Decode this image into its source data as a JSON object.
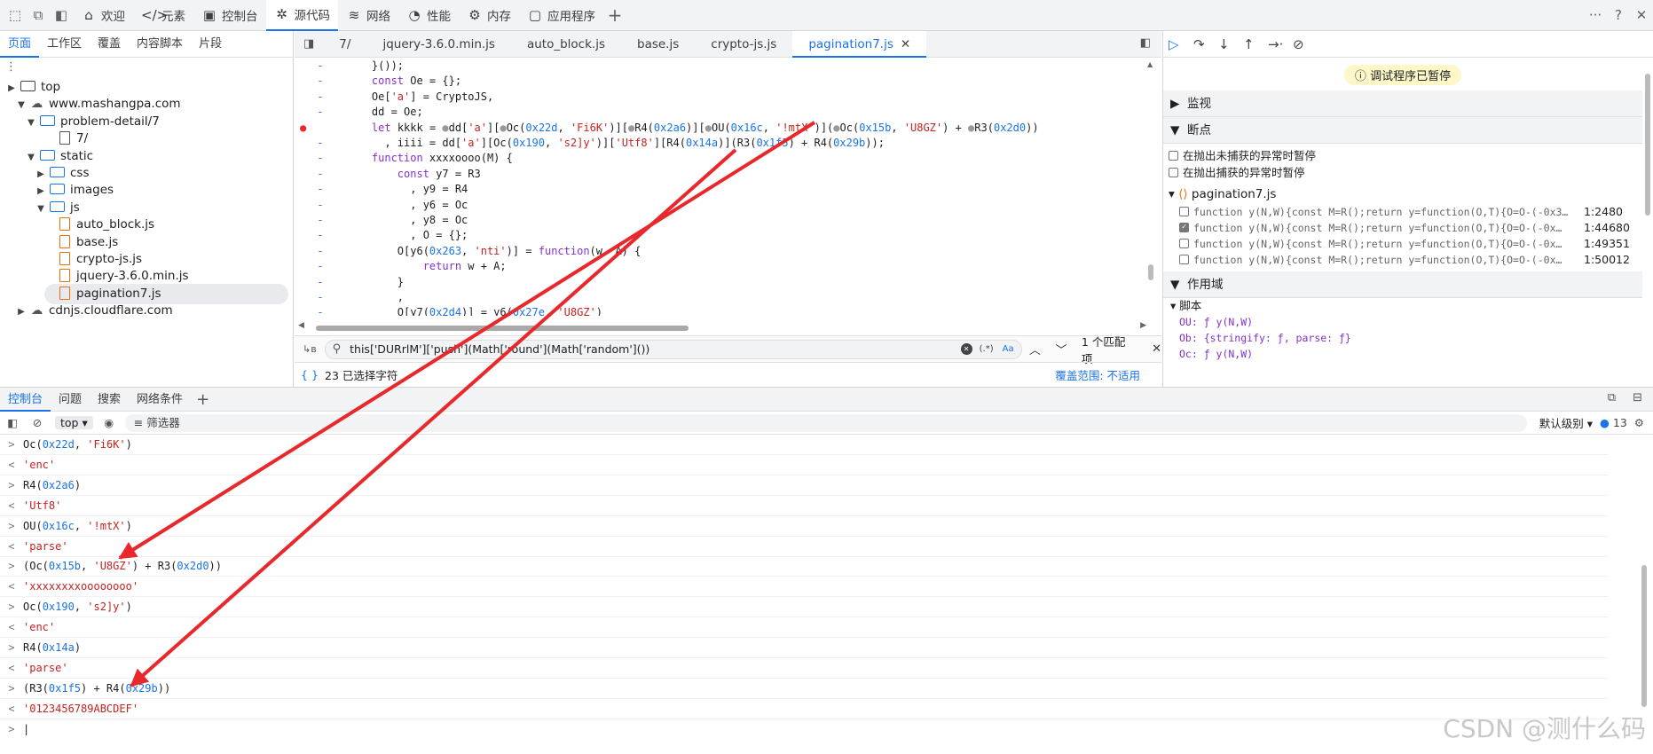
{
  "toolbar": {
    "tabs": [
      {
        "label": "欢迎",
        "icon": "home-icon",
        "glyph": "⌂"
      },
      {
        "label": "元素",
        "icon": "code-icon",
        "glyph": "</>"
      },
      {
        "label": "控制台",
        "icon": "console-icon",
        "glyph": "▣"
      },
      {
        "label": "源代码",
        "icon": "bug-icon",
        "glyph": "✲"
      },
      {
        "label": "网络",
        "icon": "wifi-icon",
        "glyph": "≋"
      },
      {
        "label": "性能",
        "icon": "gauge-icon",
        "glyph": "◔"
      },
      {
        "label": "内存",
        "icon": "gear-icon",
        "glyph": "⚙"
      },
      {
        "label": "应用程序",
        "icon": "app-icon",
        "glyph": "▢"
      }
    ],
    "add": "+",
    "more": "···",
    "help": "?",
    "close": "✕"
  },
  "navigator": {
    "tabs": [
      "页面",
      "工作区",
      "覆盖",
      "内容脚本",
      "片段"
    ],
    "tree": [
      {
        "label": "top",
        "type": "window",
        "indent": 0,
        "tri": "▶"
      },
      {
        "label": "www.mashangpa.com",
        "type": "cloud",
        "indent": 1,
        "tri": "▼"
      },
      {
        "label": "problem-detail/7",
        "type": "folder",
        "indent": 2,
        "tri": "▼"
      },
      {
        "label": "7/",
        "type": "plain",
        "indent": 4,
        "tri": ""
      },
      {
        "label": "static",
        "type": "folder",
        "indent": 2,
        "tri": "▼"
      },
      {
        "label": "css",
        "type": "folder",
        "indent": 3,
        "tri": "▶"
      },
      {
        "label": "images",
        "type": "folder",
        "indent": 3,
        "tri": "▶"
      },
      {
        "label": "js",
        "type": "folder",
        "indent": 3,
        "tri": "▼"
      },
      {
        "label": "auto_block.js",
        "type": "file",
        "indent": 4,
        "tri": ""
      },
      {
        "label": "base.js",
        "type": "file",
        "indent": 4,
        "tri": ""
      },
      {
        "label": "crypto-js.js",
        "type": "file",
        "indent": 4,
        "tri": ""
      },
      {
        "label": "jquery-3.6.0.min.js",
        "type": "file",
        "indent": 4,
        "tri": ""
      },
      {
        "label": "pagination7.js",
        "type": "file",
        "indent": 4,
        "tri": "",
        "selected": true
      },
      {
        "label": "cdnjs.cloudflare.com",
        "type": "cloud",
        "indent": 1,
        "tri": "▶"
      }
    ]
  },
  "editor": {
    "tabs": [
      "7/",
      "jquery-3.6.0.min.js",
      "auto_block.js",
      "base.js",
      "crypto-js.js",
      "pagination7.js"
    ],
    "code": [
      "    }());",
      "    const Oe = {};",
      "    Oe['a'] = CryptoJS,",
      "    dd = Oe;",
      "    let kkkk = ●dd['a'][●Oc(0x22d, 'Fi6K')][●R4(0x2a6)][●OU(0x16c, '!mtX')](●Oc(0x15b, 'U8GZ') + ●R3(0x2d0))",
      "      , iiii = dd['a'][Oc(0x190, 's2]y')]['Utf8'][R4(0x14a)](R3(0x1f5) + R4(0x29b));",
      "    function xxxxoooo(M) {",
      "        const y7 = R3",
      "          , y9 = R4",
      "          , y6 = Oc",
      "          , y8 = Oc",
      "          , O = {};",
      "        O[y6(0x263, 'nti')] = function(w, A) {",
      "            return w + A;",
      "        }",
      "        ,",
      "        O[y7(0x2d4)] = y6(0x27e, 'U8GZ')"
    ],
    "search": {
      "query": "this['DURrlM']['push'](Math['round'](Math['random']())",
      "matches": "1 个匹配项",
      "aa": "Aa",
      "regex": "(.*)"
    },
    "status": {
      "selected": "23 已选择字符",
      "coverage": "覆盖范围: 不适用"
    }
  },
  "debugger": {
    "paused": "调试程序已暂停",
    "watch": "监视",
    "breakpoints": "断点",
    "pause_uncaught": "在抛出未捕获的异常时暂停",
    "pause_caught": "在抛出捕获的异常时暂停",
    "bp_file": "pagination7.js",
    "bp_items": [
      {
        "code": "function y(N,W){const M=R();return y=function(O,T){O=O-(-0x3…",
        "loc": "1:2480",
        "checked": false
      },
      {
        "code": "function y(N,W){const M=R();return y=function(O,T){O=O-(-0x…",
        "loc": "1:44680",
        "checked": true
      },
      {
        "code": "function y(N,W){const M=R();return y=function(O,T){O=O-(-0x…",
        "loc": "1:49351",
        "checked": false
      },
      {
        "code": "function y(N,W){const M=R();return y=function(O,T){O=O-(-0x…",
        "loc": "1:50012",
        "checked": false
      }
    ],
    "scope": "作用域",
    "script": "脚本",
    "scope_items": [
      "OU: ƒ y(N,W)",
      "Ob: {stringify: ƒ, parse: ƒ}",
      "Oc: ƒ y(N,W)"
    ]
  },
  "console": {
    "tabs": [
      "控制台",
      "问题",
      "搜索",
      "网络条件"
    ],
    "context": "top",
    "filter": "筛选器",
    "level": "默认级别",
    "issues": "13",
    "rows": [
      {
        "dir": ">",
        "text": "Oc(0x22d, 'Fi6K')"
      },
      {
        "dir": "<",
        "text": "'enc'"
      },
      {
        "dir": ">",
        "text": "R4(0x2a6)"
      },
      {
        "dir": "<",
        "text": "'Utf8'"
      },
      {
        "dir": ">",
        "text": "OU(0x16c, '!mtX')"
      },
      {
        "dir": "<",
        "text": "'parse'"
      },
      {
        "dir": ">",
        "text": "(Oc(0x15b, 'U8GZ') + R3(0x2d0))"
      },
      {
        "dir": "<",
        "text": "'xxxxxxxxoooooooo'"
      },
      {
        "dir": ">",
        "text": "Oc(0x190, 's2]y')"
      },
      {
        "dir": "<",
        "text": "'enc'"
      },
      {
        "dir": ">",
        "text": "R4(0x14a)"
      },
      {
        "dir": "<",
        "text": "'parse'"
      },
      {
        "dir": ">",
        "text": "(R3(0x1f5) + R4(0x29b))"
      },
      {
        "dir": "<",
        "text": "'0123456789ABCDEF'"
      }
    ],
    "prompt": ">"
  },
  "watermark": "CSDN @测什么码",
  "colors": {
    "accent": "#1a73e8",
    "annotation": "#e8282b",
    "paused_badge": "#fef7c7"
  }
}
